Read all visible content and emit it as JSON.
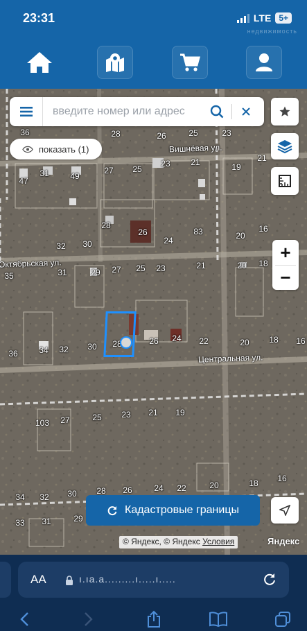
{
  "status": {
    "time": "23:31",
    "network": "LTE",
    "battery": "5+",
    "watermark": "недвижимость"
  },
  "header": {
    "home_icon": "home-icon",
    "map_icon": "map-pin-icon",
    "cart_icon": "cart-icon",
    "user_icon": "user-icon"
  },
  "search": {
    "placeholder": "введите номер или адрес",
    "value": ""
  },
  "show_filter": {
    "label": "показать (1)"
  },
  "map": {
    "streets": [
      "Вишнёвая ул.",
      "Октябрьская ул.",
      "Центральная ул."
    ],
    "plot_numbers": [
      "36",
      "28",
      "26",
      "25",
      "23",
      "21",
      "19",
      "17",
      "47",
      "31",
      "49",
      "27",
      "25",
      "23",
      "21",
      "19",
      "28",
      "26",
      "83",
      "32",
      "30",
      "24",
      "20",
      "16",
      "35",
      "31",
      "29",
      "27",
      "25",
      "23",
      "21",
      "20",
      "18",
      "16",
      "36",
      "34",
      "32",
      "30",
      "28",
      "26",
      "24",
      "22",
      "20",
      "18",
      "16",
      "103",
      "27",
      "25",
      "23",
      "21",
      "19",
      "28",
      "26",
      "24",
      "22",
      "20",
      "18",
      "16",
      "34",
      "32",
      "30",
      "33",
      "31",
      "29"
    ],
    "selected_plot": "28"
  },
  "buttons": {
    "cadastral": "Кадастровые границы",
    "zoom_in": "+",
    "zoom_out": "−"
  },
  "attribution": {
    "prefix": "© Яндекс, © Яндекс ",
    "terms": "Условия",
    "logo": "Яндекс"
  },
  "browser": {
    "aa_label": "AA",
    "url": "ı.ıа.а.........ı.....ı....."
  }
}
